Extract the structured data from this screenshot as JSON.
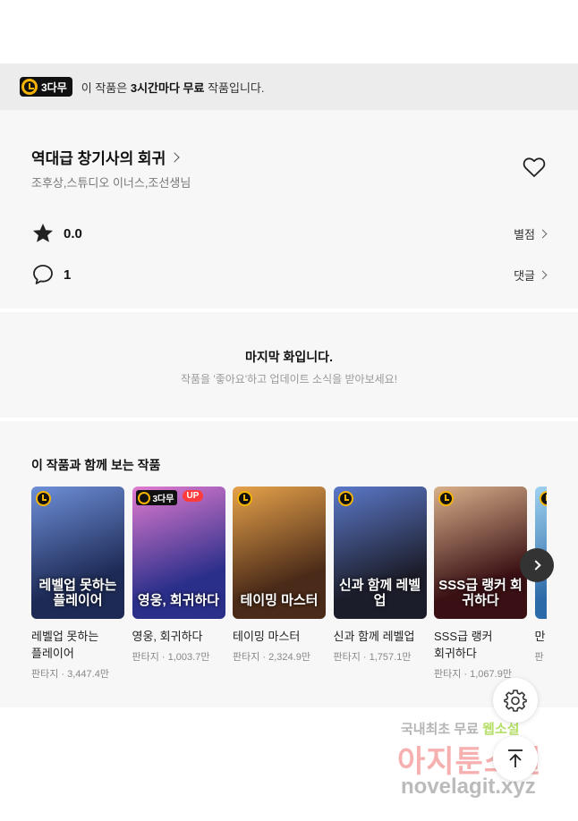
{
  "notice": {
    "badge": "3다무",
    "text_prefix": "이 작품은 ",
    "text_bold": "3시간마다 무료",
    "text_suffix": " 작품입니다."
  },
  "work": {
    "title": "역대급 창기사의 회귀",
    "authors": "조후상,스튜디오 이너스,조선생님",
    "rating": "0.0",
    "rating_link": "별점",
    "comments": "1",
    "comments_link": "댓글"
  },
  "last_episode": {
    "title": "마지막 화입니다.",
    "subtitle": "작품을 '좋아요'하고 업데이트 소식을 받아보세요!"
  },
  "recommendations": {
    "heading": "이 작품과 함께 보는 작품",
    "items": [
      {
        "name": "레벨업 못하는 플레이어",
        "meta": "판타지 · 3,447.4만",
        "cover_text": "레벨업 못하는 플레이어",
        "badge": "clock",
        "colors": [
          "#1d2a55",
          "#6e8fd8"
        ]
      },
      {
        "name": "영웅, 회귀하다",
        "meta": "판타지 · 1,003.7만",
        "cover_text": "영웅, 회귀하다",
        "badge": "3다무",
        "up": "UP",
        "colors": [
          "#2a2f8a",
          "#e27bd0"
        ]
      },
      {
        "name": "테이밍 마스터",
        "meta": "판타지 · 2,324.9만",
        "cover_text": "테이밍 마스터",
        "badge": "clock",
        "colors": [
          "#4a2a18",
          "#e6a24a"
        ]
      },
      {
        "name": "신과 함께 레벨업",
        "meta": "판타지 · 1,757.1만",
        "cover_text": "신과 함께 레벨업",
        "badge": "clock",
        "colors": [
          "#1c1d2a",
          "#5b78c9"
        ]
      },
      {
        "name": "SSS급 랭커 회귀하다",
        "meta": "판타지 · 1,067.9만",
        "cover_text": "SSS급 랭커 회귀하다",
        "badge": "clock",
        "colors": [
          "#3a1014",
          "#d8b08a"
        ]
      },
      {
        "name": "만",
        "meta": "판",
        "cover_text": "",
        "badge": "clock",
        "colors": [
          "#2b6aa8",
          "#9fd2f0"
        ]
      }
    ]
  },
  "watermark": {
    "line1_a": "국내최초 무료 ",
    "line1_b": "웹소설",
    "line2": "아지툰소설",
    "line3": "novelagit.xyz"
  },
  "colors": {
    "accent_yellow": "#f6b400",
    "up_red": "#ff3b3b"
  }
}
